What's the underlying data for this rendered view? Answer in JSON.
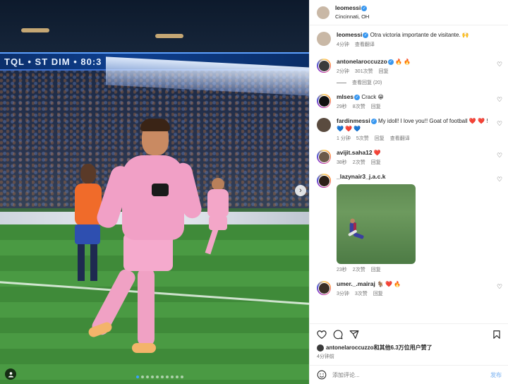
{
  "media": {
    "board_text": "TQL • ST  DIM • 80:3",
    "dots_total": 10,
    "dots_active": 0,
    "next_icon": "chevron-right-icon",
    "tag_icon": "user-tag-icon"
  },
  "header": {
    "username": "leomessi",
    "location": "Cincinnati, OH"
  },
  "caption": {
    "username": "leomessi",
    "text": "Otra victoria importante de visitante. 🙌",
    "time": "4分钟",
    "see_translation": "查看翻译"
  },
  "comments": [
    {
      "username": "antonelaroccuzzo",
      "verified": true,
      "text": "🔥 🔥",
      "time": "2分钟",
      "likes": "301次赞",
      "reply": "回复",
      "view_replies": "查看回复 (20)"
    },
    {
      "username": "mlses",
      "verified": true,
      "text": "Crack 😁",
      "time": "29秒",
      "likes": "8次赞",
      "reply": "回复"
    },
    {
      "username": "fardinmessi",
      "verified": true,
      "text": "My idoll! I love you!! Goat of football ❤️ ❤️ ! 💙 ❤️ 💙",
      "time": "1 分钟",
      "likes": "5次赞",
      "reply": "回复",
      "see_translation": "查看翻译"
    },
    {
      "username": "avijit.saha12",
      "verified": false,
      "text": "❤️",
      "time": "38秒",
      "likes": "2次赞",
      "reply": "回复"
    },
    {
      "username": "_lazynair3_j.a.c.k",
      "verified": false,
      "text": "",
      "time": "23秒",
      "likes": "2次赞",
      "reply": "回复"
    },
    {
      "username": "umer._.mairaj",
      "verified": false,
      "text": "🐐 ❤️ 🔥",
      "time": "3分钟",
      "likes": "3次赞",
      "reply": "回复"
    }
  ],
  "likes_line": "antonelaroccuzzo和其他6.3万位用户赞了",
  "post_time": "4分钟前",
  "add_comment": {
    "placeholder": "添加评论...",
    "post": "发布"
  },
  "colors": {
    "accent": "#3897f0",
    "pink": "#f1a0c6",
    "muted": "#737373"
  }
}
